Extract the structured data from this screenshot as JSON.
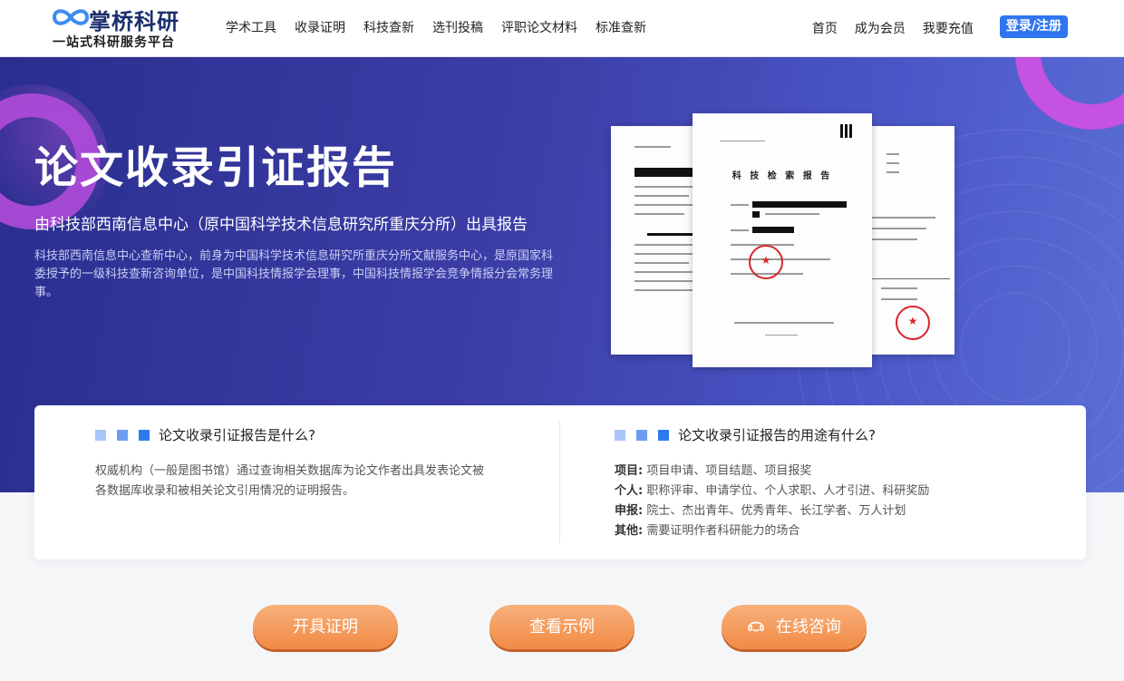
{
  "header": {
    "brand_name": "掌桥科研",
    "brand_tagline": "一站式科研服务平台",
    "nav_items": [
      {
        "label": "学术工具"
      },
      {
        "label": "收录证明"
      },
      {
        "label": "科技查新"
      },
      {
        "label": "选刊投稿"
      },
      {
        "label": "评职论文材料"
      },
      {
        "label": "标准查新"
      }
    ],
    "right_links": [
      {
        "label": "首页"
      },
      {
        "label": "成为会员"
      },
      {
        "label": "我要充值"
      }
    ],
    "login_label": "登录/注册"
  },
  "hero": {
    "title": "论文收录引证报告",
    "subtitle": "由科技部西南信息中心（原中国科学技术信息研究所重庆分所）出具报告",
    "description": "科技部西南信息中心查新中心，前身为中国科学技术信息研究所重庆分所文献服务中心，是原国家科委授予的一级科技查新咨询单位，是中国科技情报学会理事，中国科技情报学会竞争情报分会常务理事。",
    "document_title": "科 技 检 索 报 告"
  },
  "info": {
    "what": {
      "title": "论文收录引证报告是什么?",
      "body": "权威机构（一般是图书馆）通过查询相关数据库为论文作者出具发表论文被各数据库收录和被相关论文引用情况的证明报告。"
    },
    "uses": {
      "title": "论文收录引证报告的用途有什么?",
      "rows": [
        {
          "key": "项目:",
          "value": "项目申请、项目结题、项目报奖"
        },
        {
          "key": "个人:",
          "value": "职称评审、申请学位、个人求职、人才引进、科研奖励"
        },
        {
          "key": "申报:",
          "value": "院士、杰出青年、优秀青年、长江学者、万人计划"
        },
        {
          "key": "其他:",
          "value": "需要证明作者科研能力的场合"
        }
      ]
    }
  },
  "actions": {
    "issue_label": "开具证明",
    "example_label": "查看示例",
    "consult_label": "在线咨询"
  },
  "colors": {
    "brand_blue": "#2f75f0",
    "hero_bg": "#3c3ea6",
    "accent_orange": "#f28a45",
    "ring_purple": "#c552e0"
  }
}
